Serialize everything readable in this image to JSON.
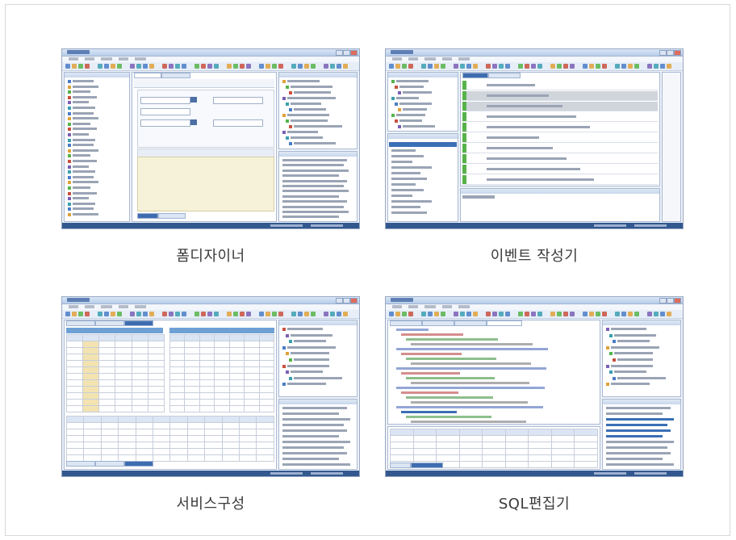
{
  "cards": [
    {
      "caption": "폼디자이너"
    },
    {
      "caption": "이벤트 작성기"
    },
    {
      "caption": "서비스구성"
    },
    {
      "caption": "SQL편집기"
    }
  ],
  "colors": {
    "window_border": "#9aa9c2",
    "title_bar": "#c7d6ec",
    "status_bar": "#32588f",
    "selection": "#3b6fb6",
    "green_marker": "#55b34a"
  }
}
